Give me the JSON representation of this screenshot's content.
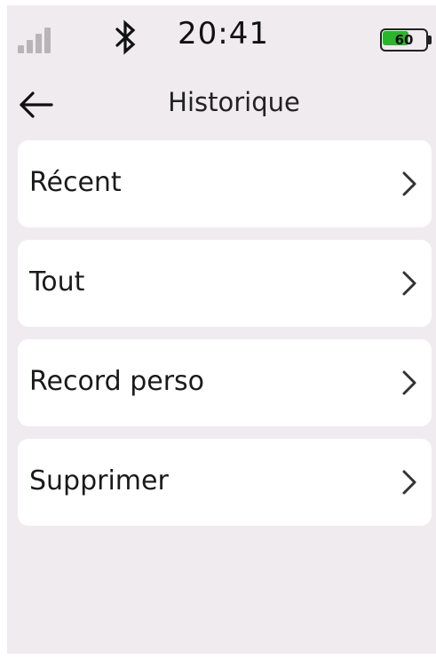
{
  "status_bar": {
    "time": "20:41",
    "battery_level": "60",
    "battery_fraction": 0.6,
    "battery_color": "#2bb52b",
    "icons": [
      "signal-icon",
      "bluetooth-icon",
      "battery-icon"
    ]
  },
  "header": {
    "title": "Historique",
    "back_icon": "back-arrow-icon"
  },
  "menu": {
    "items": [
      {
        "label": "Récent"
      },
      {
        "label": "Tout"
      },
      {
        "label": "Record perso"
      },
      {
        "label": "Supprimer"
      }
    ],
    "item_icon": "chevron-right-icon"
  },
  "colors": {
    "background": "#efebef",
    "card": "#ffffff",
    "text": "#1a1a1a"
  }
}
